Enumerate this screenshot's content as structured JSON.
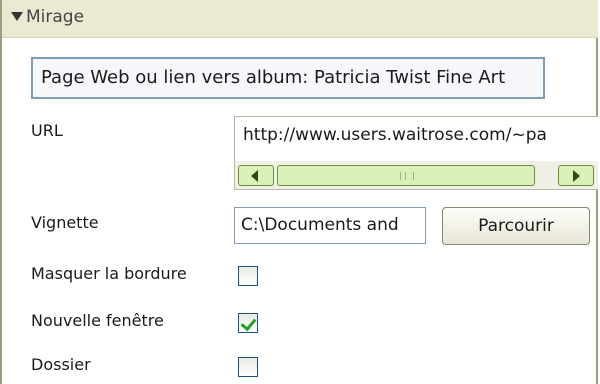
{
  "section": {
    "title": "Mirage"
  },
  "album_link": {
    "label": "Page Web ou lien vers album: Patricia Twist Fine Art"
  },
  "url": {
    "label": "URL",
    "value": "http://www.users.waitrose.com/~pa"
  },
  "thumbnail": {
    "label": "Vignette",
    "value": "C:\\Documents and",
    "browse_label": "Parcourir"
  },
  "options": {
    "hide_border": {
      "label": "Masquer la bordure",
      "checked": false
    },
    "new_window": {
      "label": "Nouvelle fenêtre",
      "checked": true
    },
    "folder": {
      "label": "Dossier",
      "checked": false
    }
  },
  "colors": {
    "header_bg": "#ece9d2",
    "scroll_green": "#d9f0b8",
    "check_green": "#21a121"
  }
}
